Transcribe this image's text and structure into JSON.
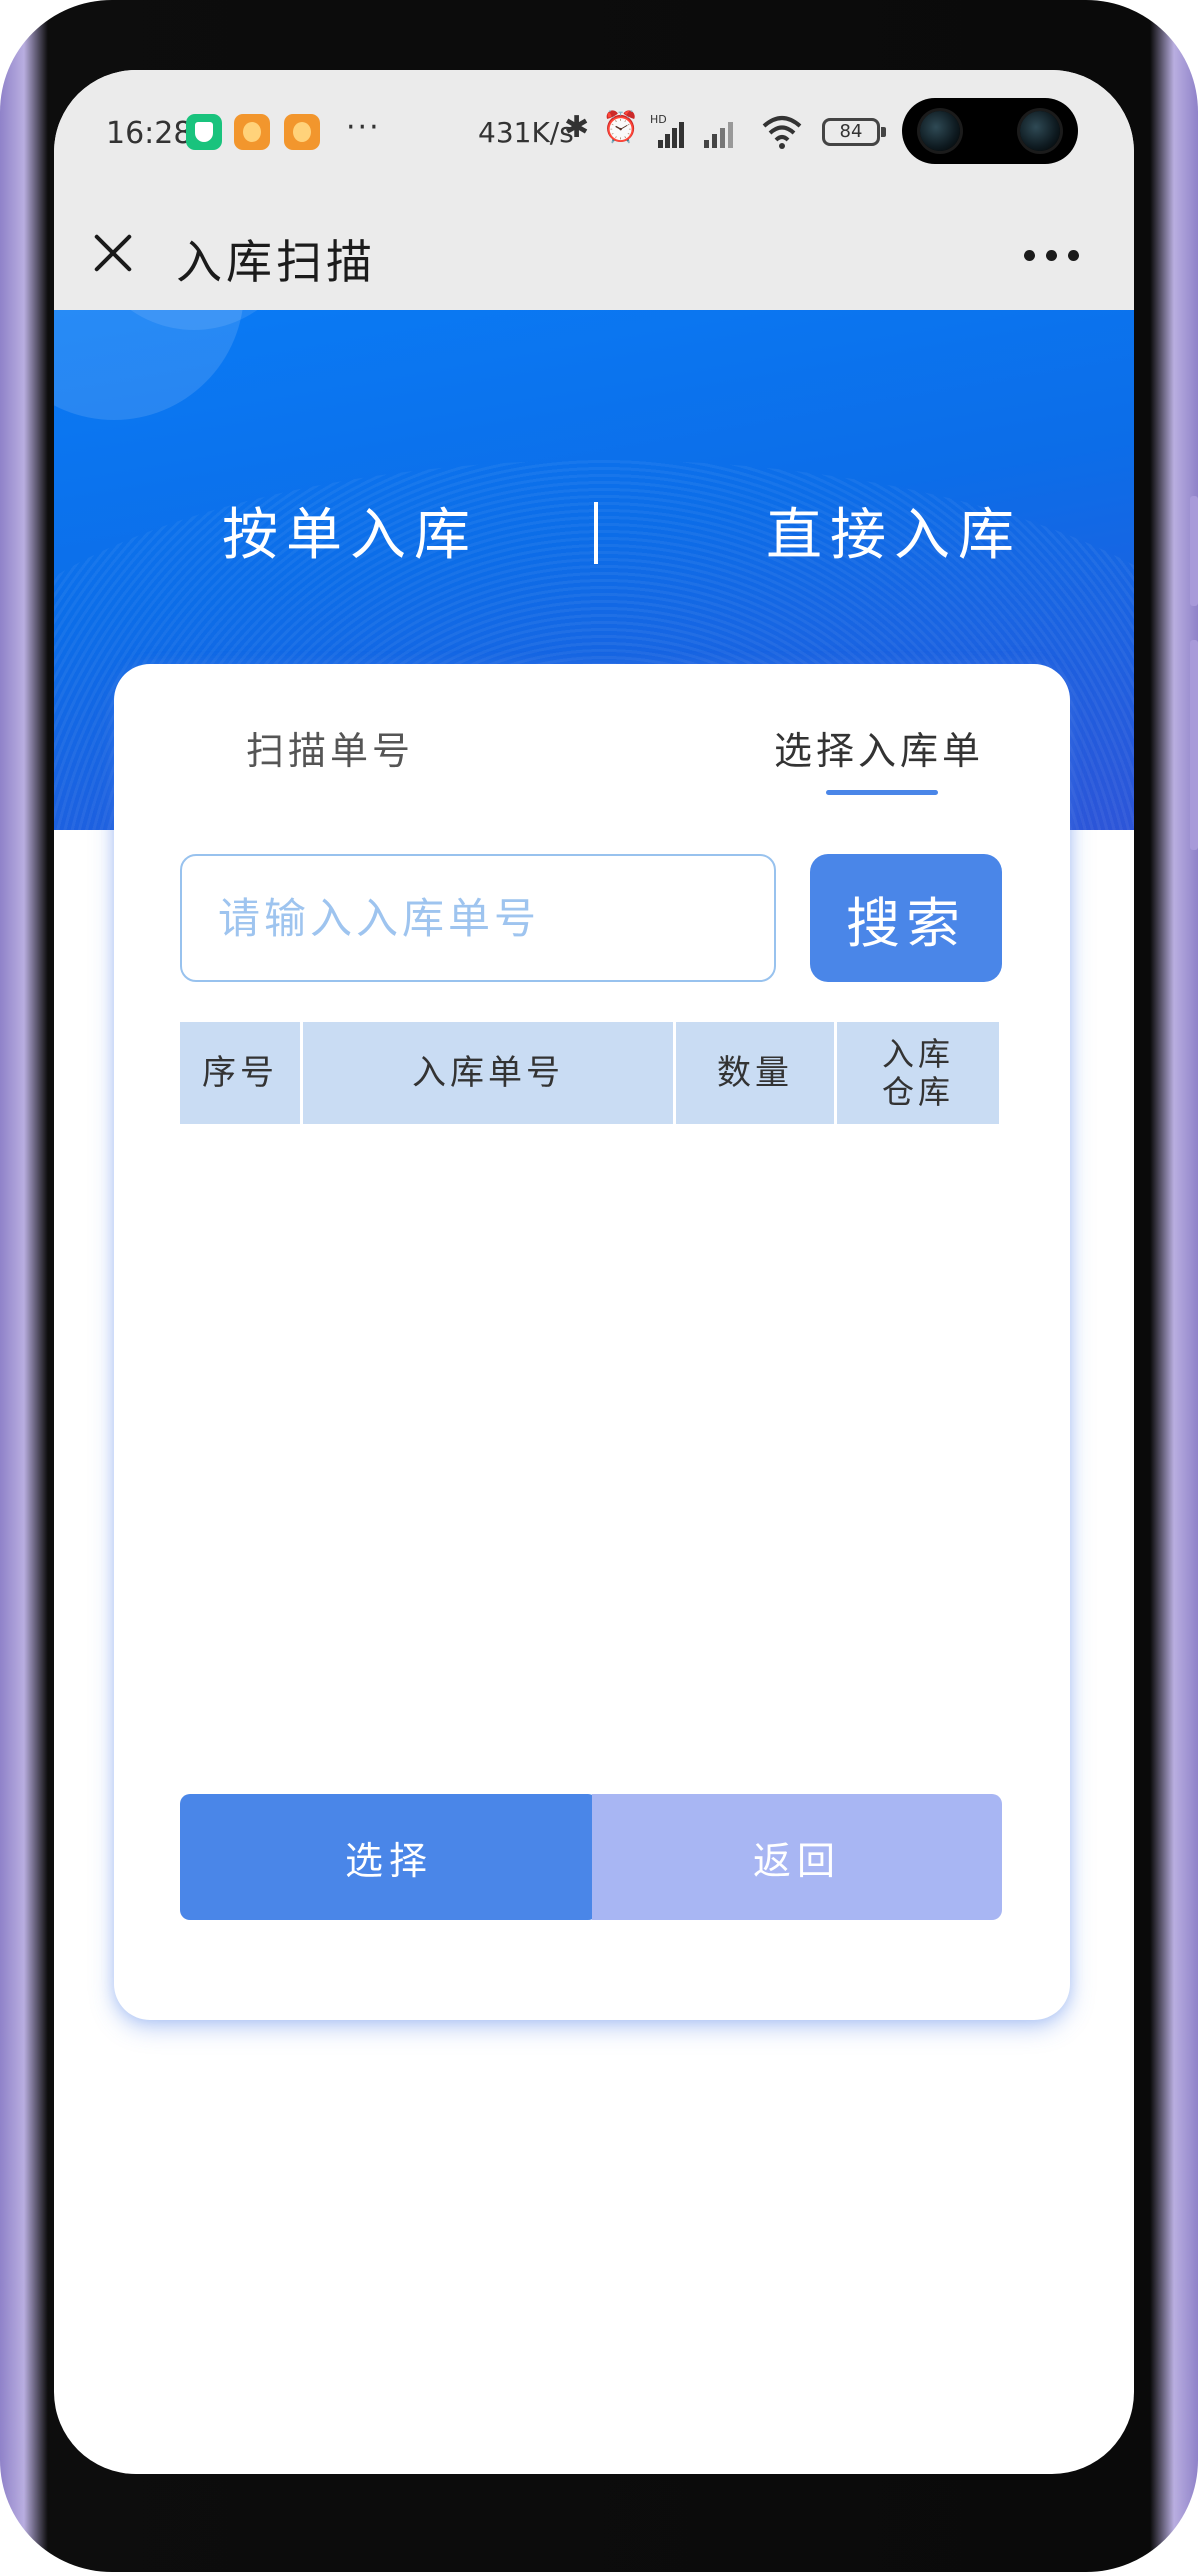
{
  "status_bar": {
    "time": "16:28",
    "dots": "···",
    "net_speed": "431K/s",
    "bluetooth_glyph": "✱",
    "alarm_glyph": "⏰",
    "hd_label": "HD",
    "battery": "84",
    "icons": [
      "shield-app-icon",
      "app-icon",
      "app-icon",
      "bluetooth-icon",
      "alarm-icon",
      "signal-icon",
      "signal-icon",
      "wifi-icon",
      "battery-icon"
    ]
  },
  "nav": {
    "title": "入库扫描",
    "close_icon": "close-icon",
    "more_icon": "more-icon"
  },
  "hero": {
    "tabs": [
      {
        "label": "按单入库",
        "active": true
      },
      {
        "label": "直接入库",
        "active": false
      }
    ]
  },
  "card": {
    "subtabs": [
      {
        "label": "扫描单号",
        "active": false
      },
      {
        "label": "选择入库单",
        "active": true
      }
    ],
    "search": {
      "placeholder": "请输入入库单号",
      "value": "",
      "button_label": "搜索"
    },
    "table": {
      "headers": [
        "序号",
        "入库单号",
        "数量",
        "入库仓库"
      ],
      "rows": []
    },
    "actions": {
      "select_label": "选择",
      "back_label": "返回"
    }
  },
  "colors": {
    "accent": "#4a86e8",
    "hero_blue": "#0a7bf5",
    "table_header": "#c9dcf3",
    "back_button": "#a8b6f3",
    "input_border": "#98c2ee"
  }
}
